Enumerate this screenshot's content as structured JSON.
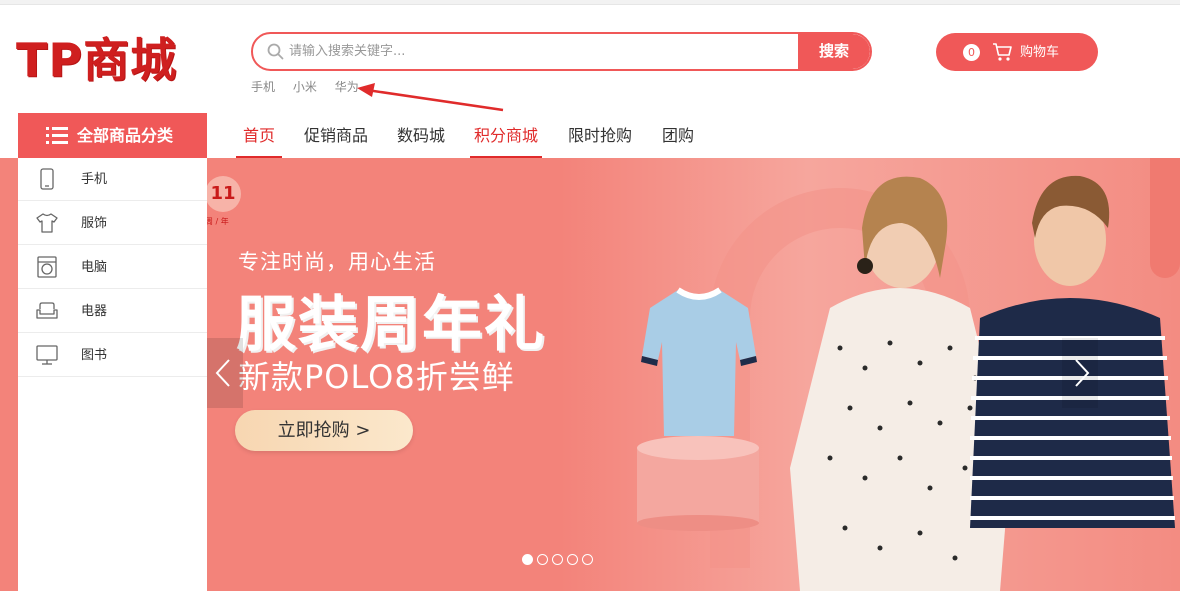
{
  "brand": {
    "logo_text": "TP商城",
    "accent_color": "#f05858",
    "dark_red": "#e02b2b"
  },
  "search": {
    "placeholder": "请输入搜索关键字...",
    "button_label": "搜索",
    "hot_words": [
      "手机",
      "小米",
      "华为"
    ]
  },
  "cart": {
    "count": "0",
    "label": "购物车"
  },
  "category_menu": {
    "header_label": "全部商品分类",
    "items": [
      {
        "label": "手机",
        "icon": "phone-icon"
      },
      {
        "label": "服饰",
        "icon": "shirt-icon"
      },
      {
        "label": "电脑",
        "icon": "washer-icon"
      },
      {
        "label": "电器",
        "icon": "sofa-icon"
      },
      {
        "label": "图书",
        "icon": "monitor-icon"
      }
    ]
  },
  "nav": {
    "items": [
      "首页",
      "促销商品",
      "数码城",
      "积分商城",
      "限时抢购",
      "团购"
    ]
  },
  "banner": {
    "badge": "11",
    "badge_sub": "周 / 年",
    "tagline": "专注时尚，用心生活",
    "headline": "服装周年礼",
    "subline": "新款POLO8折尝鲜",
    "cta_label": "立即抢购 >",
    "slide_count": 5,
    "active_slide": 1
  }
}
